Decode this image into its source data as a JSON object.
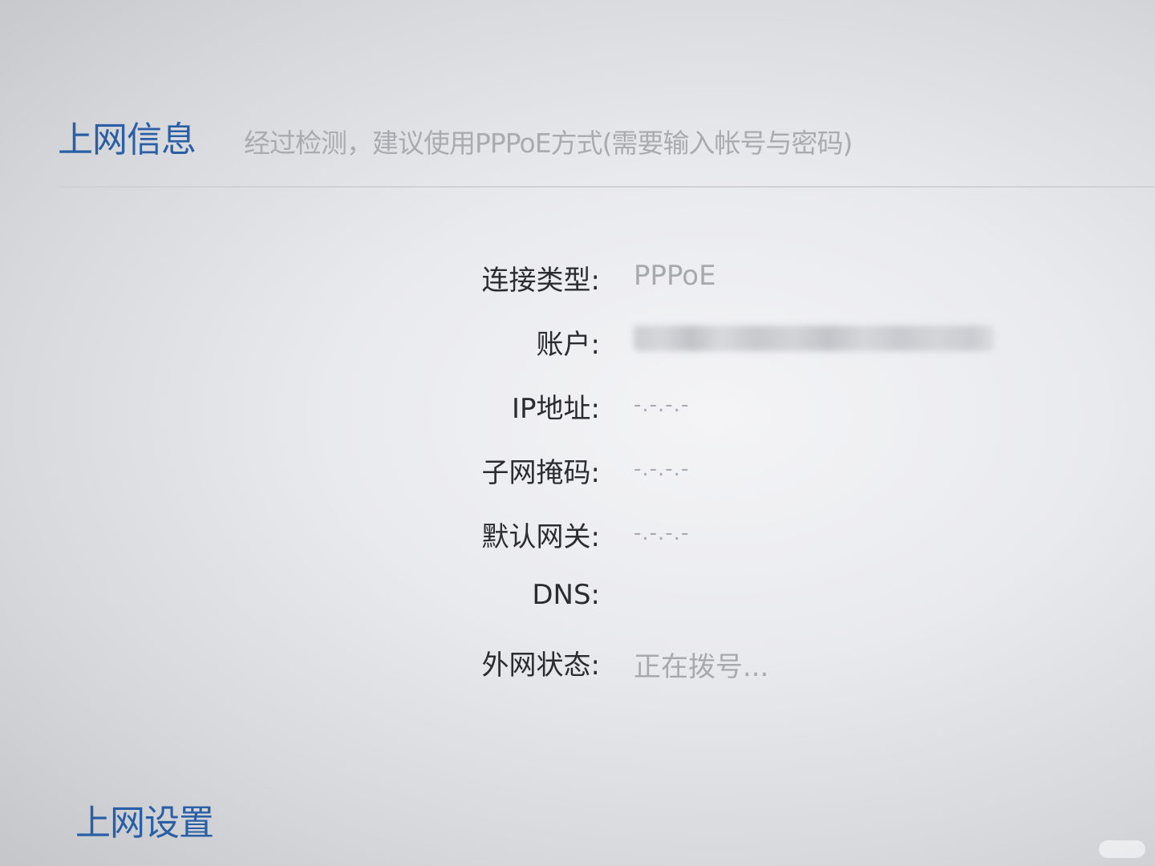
{
  "header": {
    "title": "上网信息",
    "notice": "经过检测，建议使用PPPoE方式(需要输入帐号与密码)"
  },
  "info": {
    "rows": [
      {
        "label": "连接类型:",
        "value": "PPPoE"
      },
      {
        "label": "账户:",
        "value": ""
      },
      {
        "label": "IP地址:",
        "value": "-.-.-.-"
      },
      {
        "label": "子网掩码:",
        "value": "-.-.-.-"
      },
      {
        "label": "默认网关:",
        "value": "-.-.-.-"
      },
      {
        "label": "DNS:",
        "value": ""
      },
      {
        "label": "外网状态:",
        "value": "正在拨号..."
      }
    ]
  },
  "footer": {
    "title": "上网设置"
  },
  "colors": {
    "accent": "#2a5fa6",
    "label": "#2b2c30",
    "muted": "#a7a9ae"
  }
}
